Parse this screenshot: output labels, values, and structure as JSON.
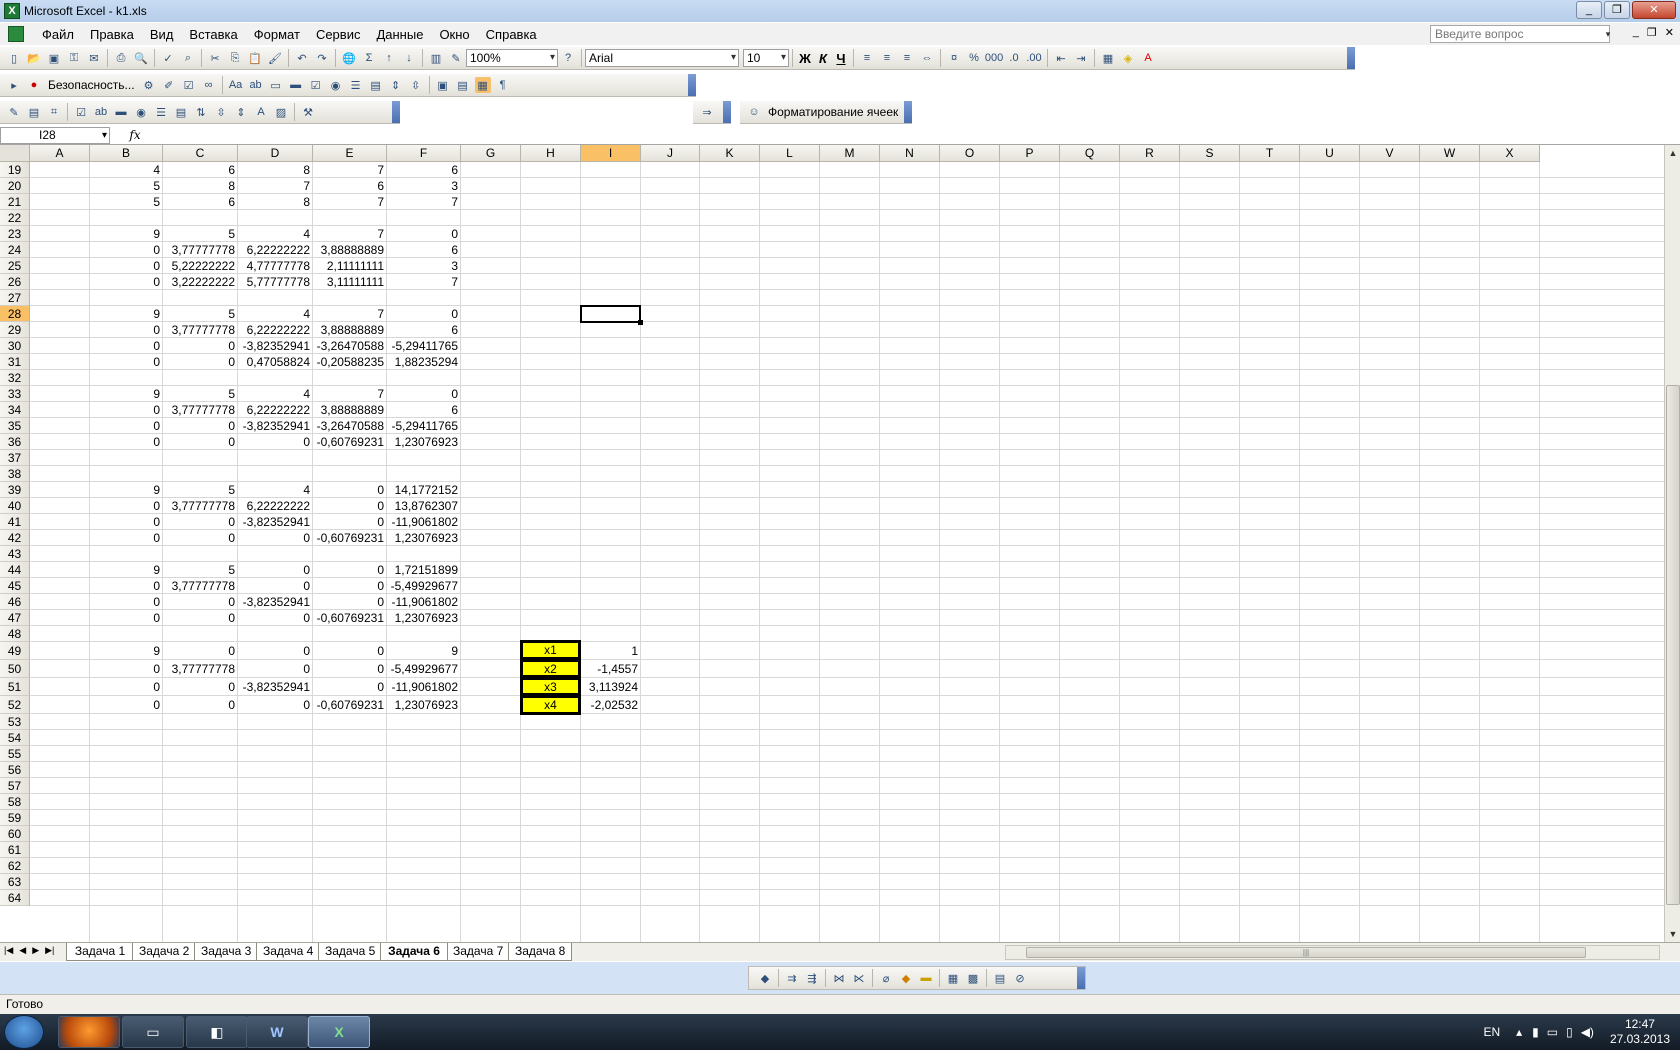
{
  "window": {
    "title": "Microsoft Excel - k1.xls"
  },
  "menu": [
    "Файл",
    "Правка",
    "Вид",
    "Вставка",
    "Формат",
    "Сервис",
    "Данные",
    "Окно",
    "Справка"
  ],
  "ask_placeholder": "Введите вопрос",
  "toolbar": {
    "zoom": "100%",
    "font": "Arial",
    "size": "10",
    "security_label": "Безопасность...",
    "format_cells_label": "Форматирование ячеек",
    "bold": "Ж",
    "italic": "К",
    "underline": "Ч"
  },
  "formula_bar": {
    "name_box": "I28",
    "fx": "fx",
    "value": ""
  },
  "columns": [
    "A",
    "B",
    "C",
    "D",
    "E",
    "F",
    "G",
    "H",
    "I",
    "J",
    "K",
    "L",
    "M",
    "N",
    "O",
    "P",
    "Q",
    "R",
    "S",
    "T",
    "U",
    "V",
    "W",
    "X"
  ],
  "selected_column": "I",
  "rows": [
    "19",
    "20",
    "21",
    "22",
    "23",
    "24",
    "25",
    "26",
    "27",
    "28",
    "29",
    "30",
    "31",
    "32",
    "33",
    "34",
    "35",
    "36",
    "37",
    "38",
    "39",
    "40",
    "41",
    "42",
    "43",
    "44",
    "45",
    "46",
    "47",
    "48",
    "49",
    "50",
    "51",
    "52",
    "53",
    "54",
    "55",
    "56",
    "57",
    "58",
    "59",
    "60",
    "61",
    "62",
    "63",
    "64"
  ],
  "selected_row": "28",
  "cells": {
    "19": [
      "4",
      "6",
      "8",
      "7",
      "6"
    ],
    "20": [
      "5",
      "8",
      "7",
      "6",
      "3"
    ],
    "21": [
      "5",
      "6",
      "8",
      "7",
      "7"
    ],
    "23": [
      "9",
      "5",
      "4",
      "7",
      "0"
    ],
    "24": [
      "0",
      "3,77777778",
      "6,22222222",
      "3,88888889",
      "6"
    ],
    "25": [
      "0",
      "5,22222222",
      "4,77777778",
      "2,11111111",
      "3"
    ],
    "26": [
      "0",
      "3,22222222",
      "5,77777778",
      "3,11111111",
      "7"
    ],
    "28": [
      "9",
      "5",
      "4",
      "7",
      "0"
    ],
    "29": [
      "0",
      "3,77777778",
      "6,22222222",
      "3,88888889",
      "6"
    ],
    "30": [
      "0",
      "0",
      "-3,82352941",
      "-3,26470588",
      "-5,29411765"
    ],
    "31": [
      "0",
      "0",
      "0,47058824",
      "-0,20588235",
      "1,88235294"
    ],
    "33": [
      "9",
      "5",
      "4",
      "7",
      "0"
    ],
    "34": [
      "0",
      "3,77777778",
      "6,22222222",
      "3,88888889",
      "6"
    ],
    "35": [
      "0",
      "0",
      "-3,82352941",
      "-3,26470588",
      "-5,29411765"
    ],
    "36": [
      "0",
      "0",
      "0",
      "-0,60769231",
      "1,23076923"
    ],
    "39": [
      "9",
      "5",
      "4",
      "0",
      "14,1772152"
    ],
    "40": [
      "0",
      "3,77777778",
      "6,22222222",
      "0",
      "13,8762307"
    ],
    "41": [
      "0",
      "0",
      "-3,82352941",
      "0",
      "-11,9061802"
    ],
    "42": [
      "0",
      "0",
      "0",
      "-0,60769231",
      "1,23076923"
    ],
    "44": [
      "9",
      "5",
      "0",
      "0",
      "1,72151899"
    ],
    "45": [
      "0",
      "3,77777778",
      "0",
      "0",
      "-5,49929677"
    ],
    "46": [
      "0",
      "0",
      "-3,82352941",
      "0",
      "-11,9061802"
    ],
    "47": [
      "0",
      "0",
      "0",
      "-0,60769231",
      "1,23076923"
    ],
    "49": [
      "9",
      "0",
      "0",
      "0",
      "9"
    ],
    "50": [
      "0",
      "3,77777778",
      "0",
      "0",
      "-5,49929677"
    ],
    "51": [
      "0",
      "0",
      "-3,82352941",
      "0",
      "-11,9061802"
    ],
    "52": [
      "0",
      "0",
      "0",
      "-0,60769231",
      "1,23076923"
    ]
  },
  "results": [
    {
      "label": "x1",
      "value": "1"
    },
    {
      "label": "x2",
      "value": "-1,4557"
    },
    {
      "label": "x3",
      "value": "3,113924"
    },
    {
      "label": "x4",
      "value": "-2,02532"
    }
  ],
  "sheets": [
    "Задача 1",
    "Задача 2",
    "Задача 3",
    "Задача 4",
    "Задача 5",
    "Задача 6",
    "Задача 7",
    "Задача 8"
  ],
  "active_sheet": "Задача 6",
  "status": "Готово",
  "taskbar": {
    "lang": "EN",
    "time": "12:47",
    "date": "27.03.2013"
  },
  "colors": {
    "highlight": "#ffff00",
    "selection_header": "#f9c065"
  }
}
